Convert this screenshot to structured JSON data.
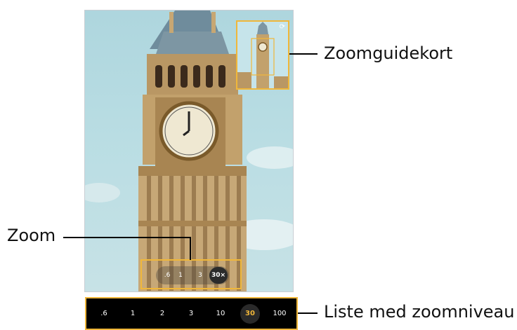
{
  "callouts": {
    "guide_map": "Zoomguidekort",
    "zoom": "Zoom",
    "zoom_list": "Liste med zoomniveau"
  },
  "zoom_pill": {
    "levels": [
      ".6",
      "1",
      "3",
      "30×"
    ],
    "selected": "30×"
  },
  "zoom_list": {
    "levels": [
      ".6",
      "1",
      "2",
      "3",
      "10",
      "30",
      "100"
    ],
    "selected": "30"
  },
  "colors": {
    "highlight": "#f0b73a",
    "bar_background": "#000000"
  },
  "icons": {
    "guide_map_camera": "camera-switch-icon"
  }
}
